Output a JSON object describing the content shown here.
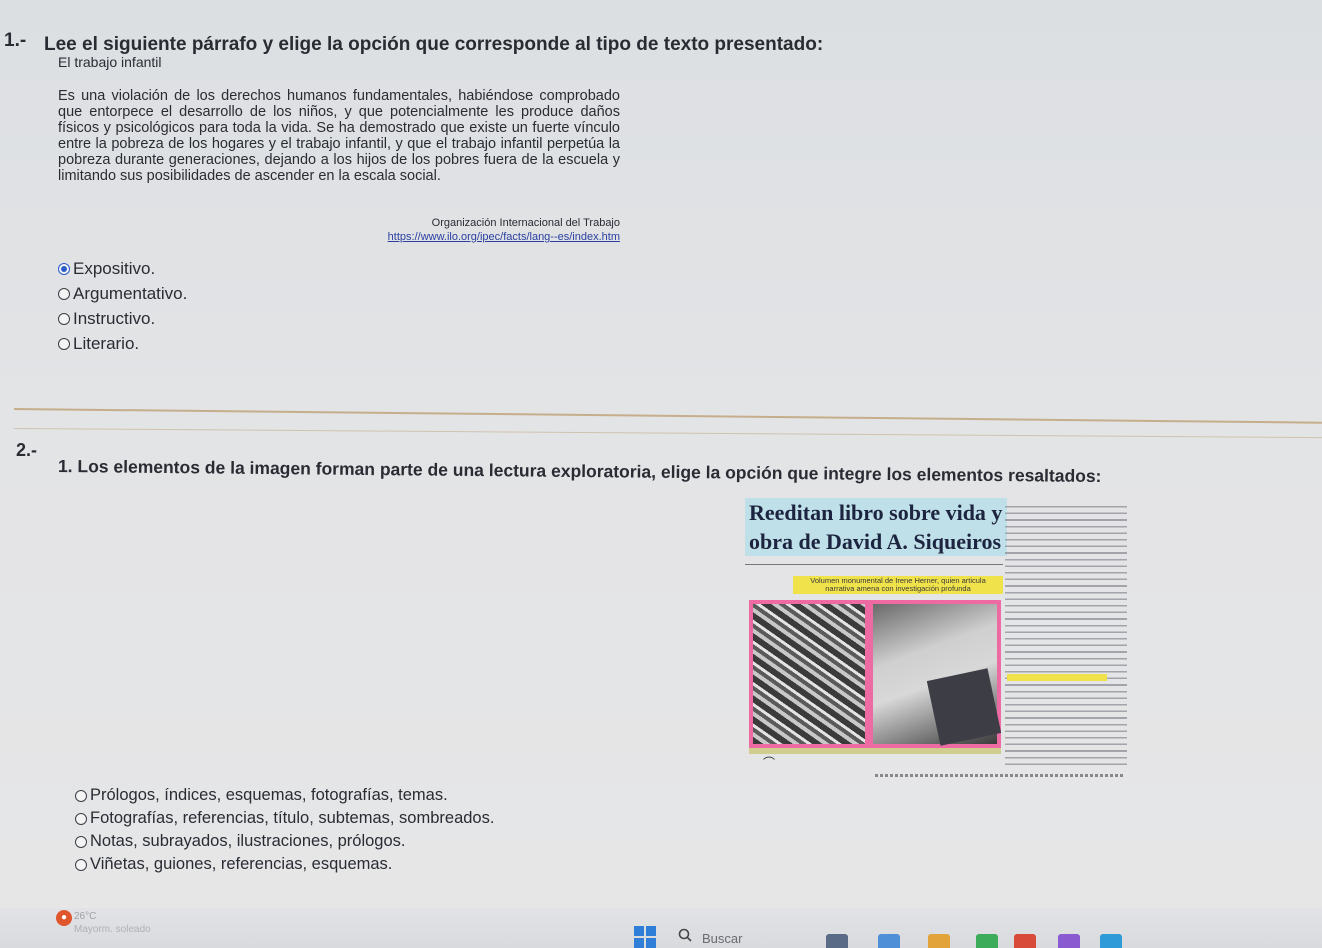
{
  "question1": {
    "number": "1.-",
    "prompt": "Lee el siguiente párrafo y elige la opción que corresponde al tipo de texto presentado:",
    "subtitle": "El trabajo infantil",
    "paragraph": "Es una violación de los derechos humanos fundamentales, habiéndose comprobado que entorpece el desarrollo de los niños, y que potencialmente les produce daños físicos y psicológicos para toda la vida. Se ha demostrado que existe un fuerte vínculo entre la pobreza de los hogares y el trabajo infantil, y que el trabajo infantil perpetúa la pobreza durante generaciones, dejando a los hijos de los pobres fuera de la escuela y limitando sus posibilidades de ascender en la escala social.",
    "source_org": "Organización Internacional del Trabajo",
    "source_url": "https://www.ilo.org/ipec/facts/lang--es/index.htm",
    "options": [
      {
        "label": "Expositivo.",
        "selected": true
      },
      {
        "label": "Argumentativo.",
        "selected": false
      },
      {
        "label": "Instructivo.",
        "selected": false
      },
      {
        "label": "Literario.",
        "selected": false
      }
    ]
  },
  "question2": {
    "number": "2.-",
    "prompt": "1. Los elementos de la imagen forman parte de una lectura exploratoria, elige la opción que integre los elementos resaltados:",
    "image": {
      "headline": "Reeditan libro sobre vida y obra de David A. Siqueiros",
      "subheadline": "Volumen monumental de Irene Herner, quien articula narrativa amena con investigación profunda"
    },
    "options": [
      {
        "label": "Prólogos, índices, esquemas, fotografías, temas.",
        "selected": false
      },
      {
        "label": "Fotografías, referencias, título, subtemas, sombreados.",
        "selected": false
      },
      {
        "label": "Notas, subrayados, ilustraciones, prólogos.",
        "selected": false
      },
      {
        "label": "Viñetas, guiones, referencias, esquemas.",
        "selected": false
      }
    ]
  },
  "taskbar": {
    "weather_temp": "26°C",
    "weather_desc": "Mayorm. soleado",
    "search_label": "Buscar",
    "icons": [
      "weather-icon",
      "start-icon",
      "search-icon"
    ],
    "accent": "#2f7fd8"
  }
}
